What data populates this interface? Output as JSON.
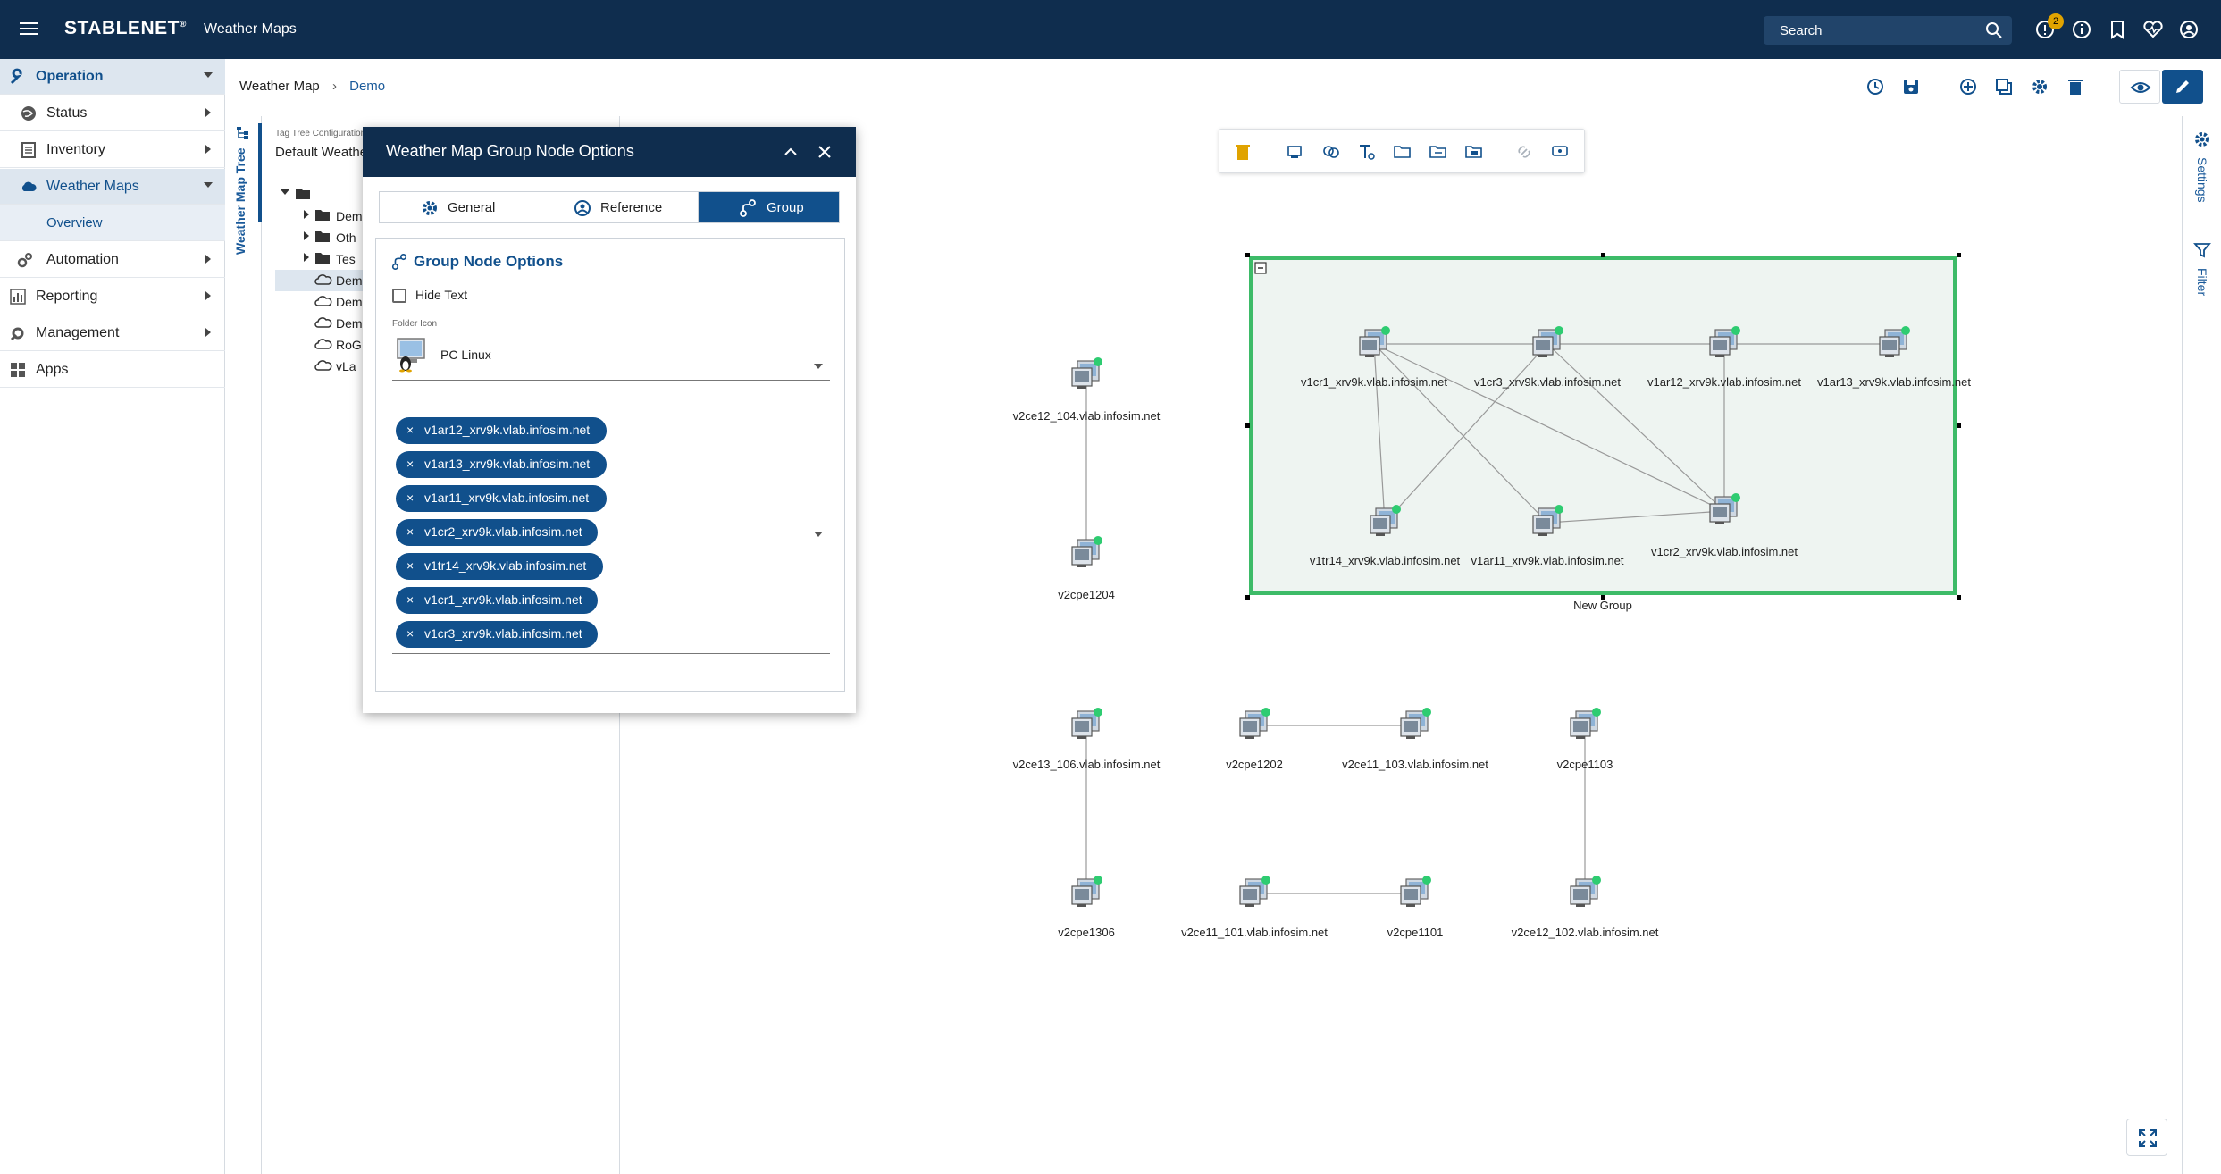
{
  "topbar": {
    "brand": "STABLENET",
    "brand_mark": "®",
    "app_name": "Weather Maps",
    "search_label": "Search",
    "notification_count": "2"
  },
  "sidebar": {
    "items": [
      {
        "label": "Operation",
        "icon": "wrench-icon"
      },
      {
        "label": "Status",
        "icon": "globe-icon"
      },
      {
        "label": "Inventory",
        "icon": "list-icon"
      },
      {
        "label": "Weather Maps",
        "icon": "cloud-icon"
      },
      {
        "label": "Overview"
      },
      {
        "label": "Automation",
        "icon": "gears-icon"
      },
      {
        "label": "Reporting",
        "icon": "chart-icon"
      },
      {
        "label": "Management",
        "icon": "gear-icon"
      },
      {
        "label": "Apps",
        "icon": "grid-icon"
      }
    ]
  },
  "breadcrumb": {
    "root": "Weather Map",
    "current": "Demo"
  },
  "tree": {
    "rail_title": "Weather Map Tree",
    "config_label": "Tag Tree Configuration",
    "config_value": "Default Weather",
    "rows": [
      "Dem",
      "Oth",
      "Tes",
      "Dem",
      "Dem",
      "Dem",
      "RoG",
      "vLa"
    ]
  },
  "right_rail": {
    "settings": "Settings",
    "filter": "Filter"
  },
  "dialog": {
    "title": "Weather Map Group Node Options",
    "tabs": [
      "General",
      "Reference",
      "Group"
    ],
    "section_title": "Group Node Options",
    "hide_text_label": "Hide Text",
    "folder_icon_label": "Folder Icon",
    "folder_icon_value": "PC Linux",
    "chips": [
      "v1ar12_xrv9k.vlab.infosim.net",
      "v1ar13_xrv9k.vlab.infosim.net",
      "v1ar11_xrv9k.vlab.infosim.net",
      "v1cr2_xrv9k.vlab.infosim.net",
      "v1tr14_xrv9k.vlab.infosim.net",
      "v1cr1_xrv9k.vlab.infosim.net",
      "v1cr3_xrv9k.vlab.infosim.net"
    ],
    "chip_remove": "×"
  },
  "map": {
    "group_label": "New Group",
    "nodes": [
      "v1cr1_xrv9k.vlab.infosim.net",
      "v1cr3_xrv9k.vlab.infosim.net",
      "v1ar12_xrv9k.vlab.infosim.net",
      "v1ar13_xrv9k.vlab.infosim.net",
      "v1tr14_xrv9k.vlab.infosim.net",
      "v1ar11_xrv9k.vlab.infosim.net",
      "v1cr2_xrv9k.vlab.infosim.net",
      "v2ce12_104.vlab.infosim.net",
      "v2cpe1204",
      "v2ce13_106.vlab.infosim.net",
      "v2cpe1202",
      "v2ce11_103.vlab.infosim.net",
      "v2cpe1103",
      "v2cpe1306",
      "v2ce11_101.vlab.infosim.net",
      "v2cpe1101",
      "v2ce12_102.vlab.infosim.net"
    ],
    "status_color": "#2ecc71",
    "group_border_color": "#3dbb68"
  }
}
